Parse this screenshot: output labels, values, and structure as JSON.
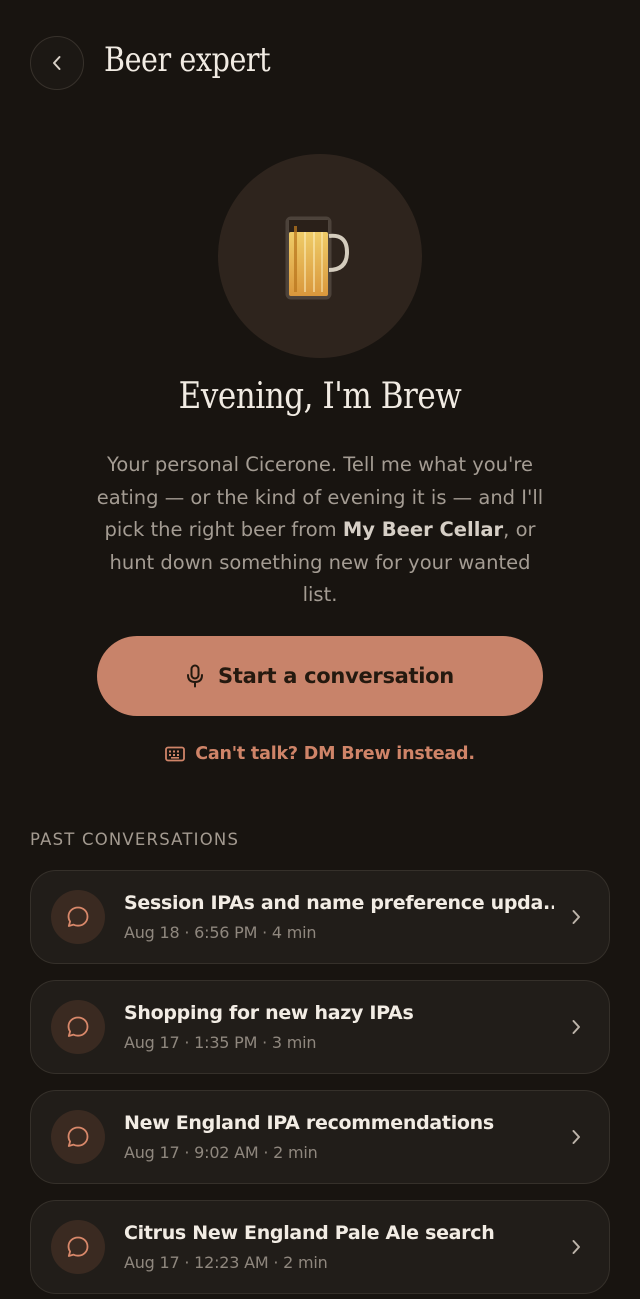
{
  "header": {
    "title": "Beer expert"
  },
  "hero": {
    "greeting": "Evening, I'm Brew",
    "intro_before": "Your personal Cicerone. Tell me what you're eating — or the kind of evening it is — and I'll pick the right beer from ",
    "intro_bold": "My Beer Cellar",
    "intro_after": ", or hunt down something new for your wanted list."
  },
  "actions": {
    "start_label": "Start a conversation",
    "dm_label": "Can't talk? DM Brew instead."
  },
  "past": {
    "section_title": "PAST CONVERSATIONS",
    "items": [
      {
        "title": "Session IPAs and name preference upda...",
        "meta": "Aug 18 · 6:56 PM · 4 min"
      },
      {
        "title": "Shopping for new hazy IPAs",
        "meta": "Aug 17 · 1:35 PM · 3 min"
      },
      {
        "title": "New England IPA recommendations",
        "meta": "Aug 17 · 9:02 AM · 2 min"
      },
      {
        "title": "Citrus New England Pale Ale search",
        "meta": "Aug 17 · 12:23 AM · 2 min"
      }
    ]
  },
  "icons": {
    "back": "chevron-left-icon",
    "avatar": "beer-mug-icon",
    "start": "microphone-icon",
    "dm": "keyboard-icon",
    "conversation": "chat-bubble-icon",
    "row": "chevron-right-icon"
  },
  "colors": {
    "background": "#181410",
    "accent": "#c8836a",
    "accent_text": "#cf8468",
    "card": "#211d19"
  }
}
